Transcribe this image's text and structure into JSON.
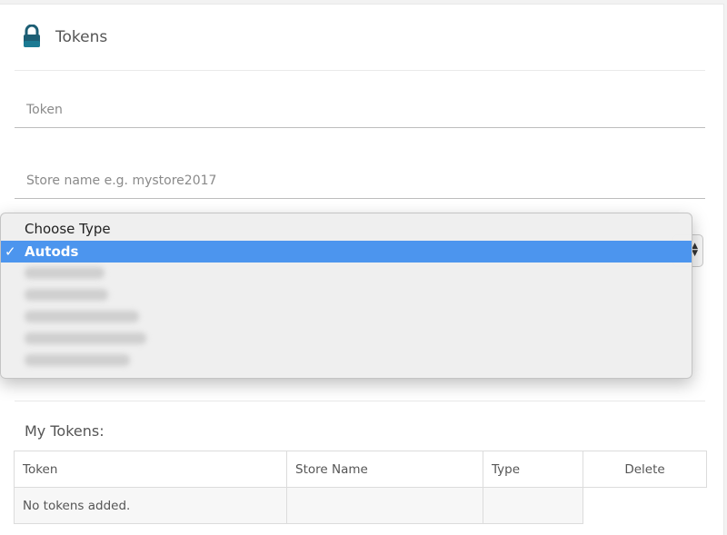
{
  "header": {
    "title": "Tokens",
    "icon": "lock-icon",
    "icon_color": "#1d5e74"
  },
  "form": {
    "token_placeholder": "Token",
    "store_placeholder": "Store name e.g. mystore2017",
    "type_select": {
      "selected": "Autods",
      "options": [
        "Choose Type",
        "Autods"
      ]
    }
  },
  "tokens_section": {
    "title": "My Tokens:",
    "columns": [
      "Token",
      "Store Name",
      "Type",
      "Delete"
    ],
    "empty_message": "No tokens added."
  },
  "colors": {
    "selection": "#4c95ee"
  }
}
